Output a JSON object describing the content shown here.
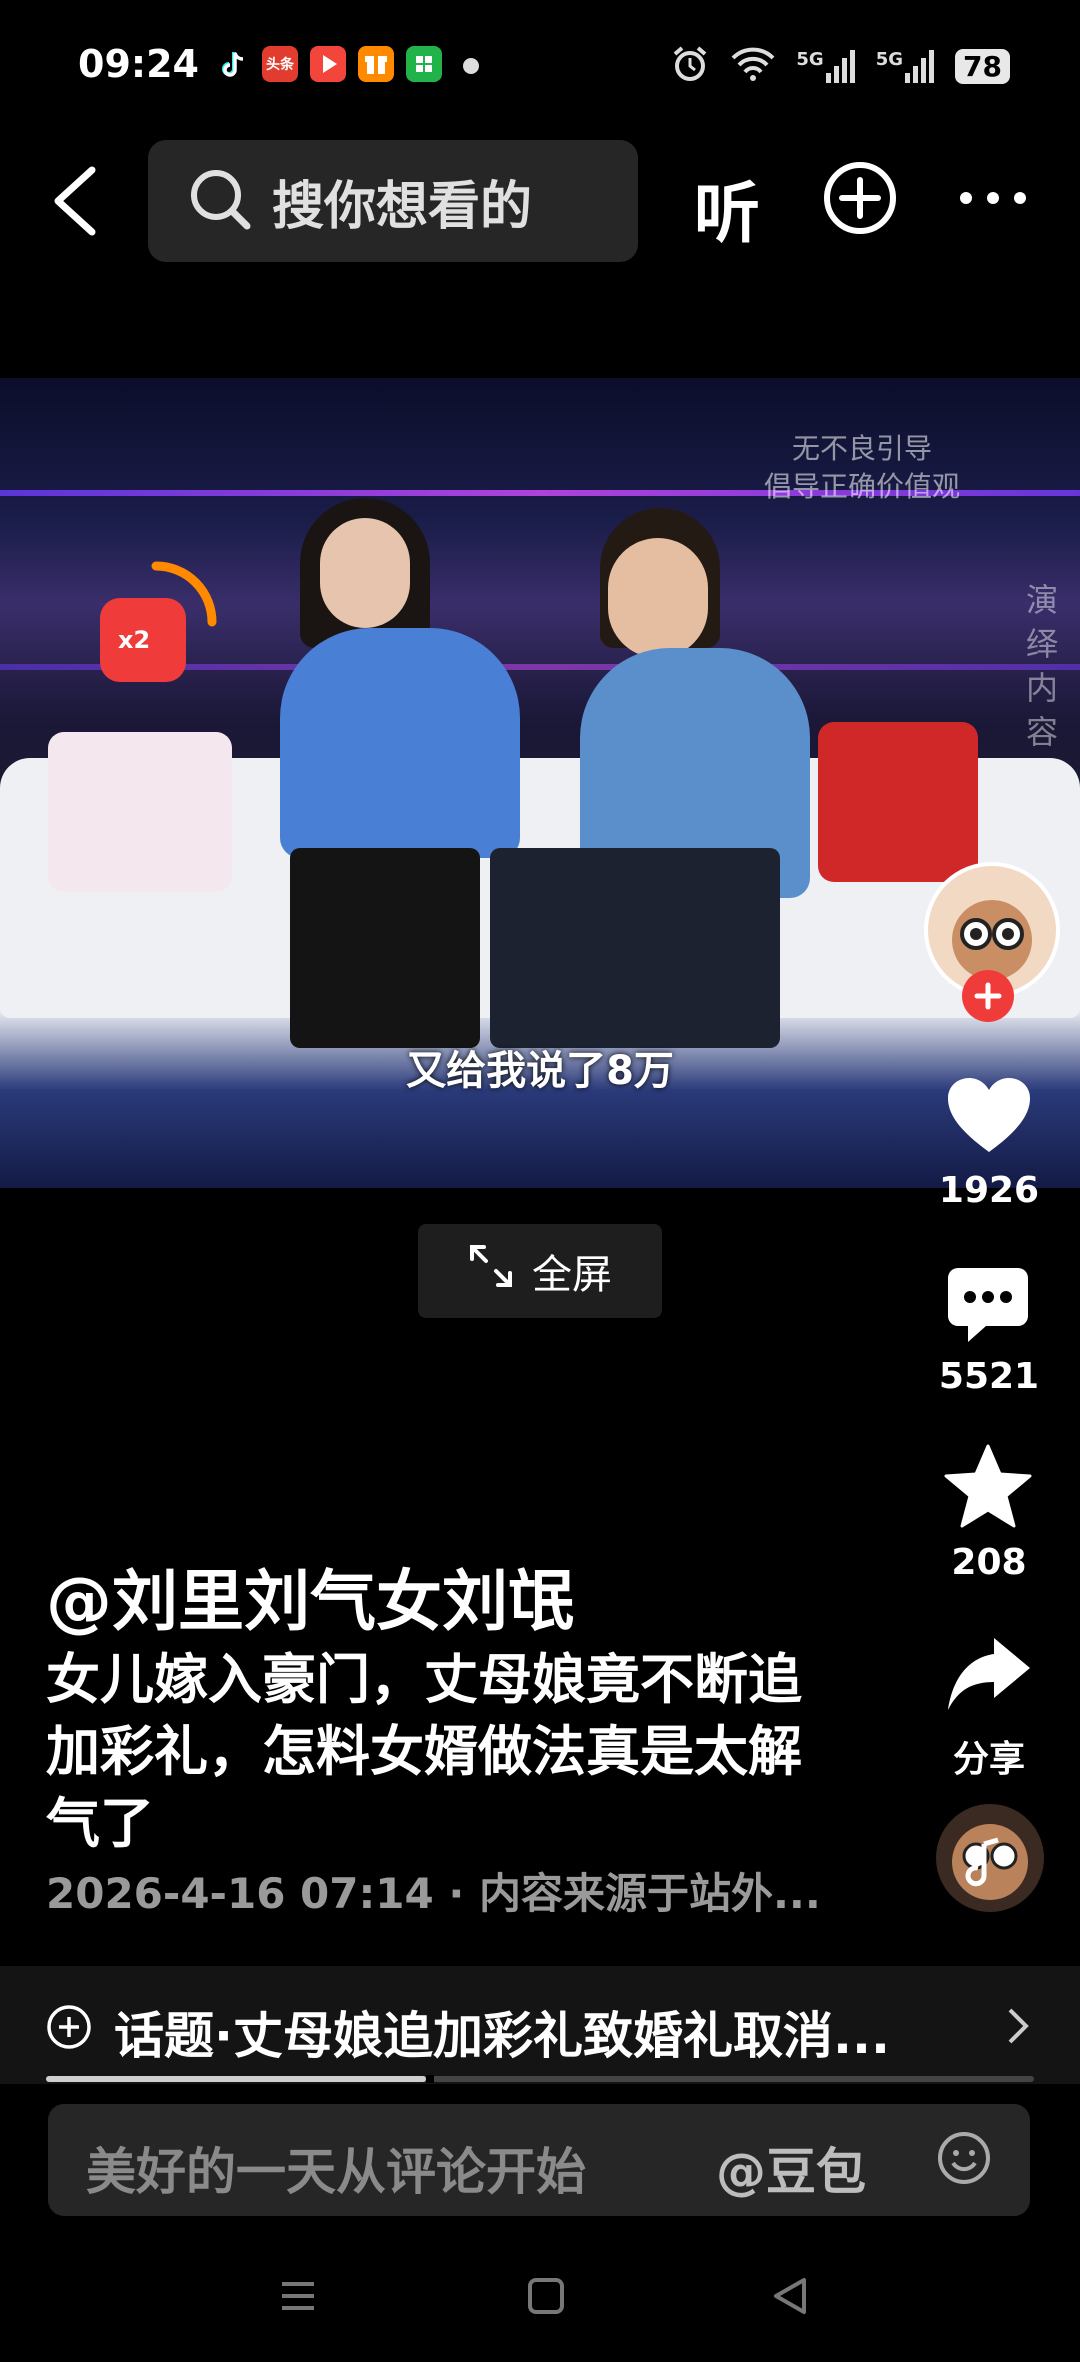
{
  "status_bar": {
    "time": "09:24",
    "app_badges": [
      {
        "icon": "tiktok-icon",
        "color": "#000000"
      },
      {
        "icon": "toutiao-icon",
        "color": "#e23c2f",
        "label": "头条"
      },
      {
        "icon": "video-play-icon",
        "color": "#f2463c"
      },
      {
        "icon": "gift-icon",
        "color": "#ff8a00"
      },
      {
        "icon": "grid-app-icon",
        "color": "#21b34a"
      }
    ],
    "signal_1": "5G",
    "signal_2": "5G",
    "battery": "78"
  },
  "header": {
    "search_placeholder": "搜你想看的",
    "listen_label": "听"
  },
  "video": {
    "subtitle": "又给我说了8万",
    "watermark_line1": "无不良引导",
    "watermark_line2": "倡导正确价值观",
    "side_watermark": "演绎内容",
    "reward_badge": "x2"
  },
  "rail": {
    "likes": "1926",
    "comments": "5521",
    "favorites": "208",
    "share_label": "分享"
  },
  "fullscreen_label": "全屏",
  "post": {
    "author": "@刘里刘气女刘氓",
    "caption": "女儿嫁入豪门，丈母娘竟不断追加彩礼，怎料女婿做法真是太解气了",
    "meta": "2026-4-16 07:14 · 内容来源于站外..."
  },
  "topic": {
    "text": "话题·丈母娘追加彩礼致婚礼取消..."
  },
  "playback_progress": 0.385,
  "comment": {
    "placeholder": "美好的一天从评论开始",
    "mention": "@豆包"
  },
  "colors": {
    "accent_red": "#f03b3b",
    "background": "#000000"
  }
}
